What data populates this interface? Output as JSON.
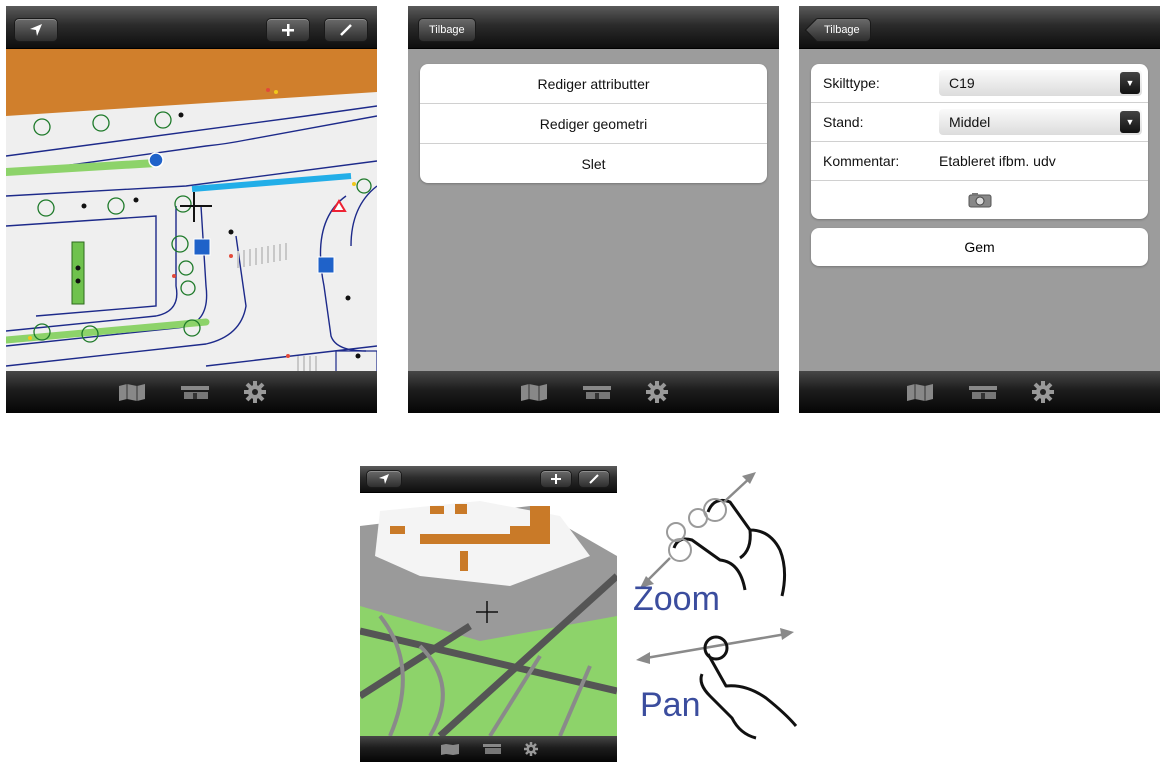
{
  "colors": {
    "accent_blue": "#22aee8",
    "orchard": "#d07f2c",
    "map_green": "#8dd36a",
    "gesture_text": "#3b4d9e"
  },
  "screens": {
    "map": {
      "icons": [
        "location-arrow-icon",
        "plus-icon",
        "pencil-icon",
        "map-icon",
        "list-icon",
        "gear-icon"
      ]
    },
    "menu": {
      "back_label": "Tilbage",
      "items": [
        "Rediger attributter",
        "Rediger geometri",
        "Slet"
      ]
    },
    "form": {
      "back_label": "Tilbage",
      "sign_type_label": "Skilttype:",
      "sign_type_value": "C19",
      "condition_label": "Stand:",
      "condition_value": "Middel",
      "comment_label": "Kommentar:",
      "comment_value": "Etableret ifbm. udv",
      "save_label": "Gem"
    },
    "overview_map": {}
  },
  "gestures": {
    "zoom_label": "Zoom",
    "pan_label": "Pan"
  }
}
